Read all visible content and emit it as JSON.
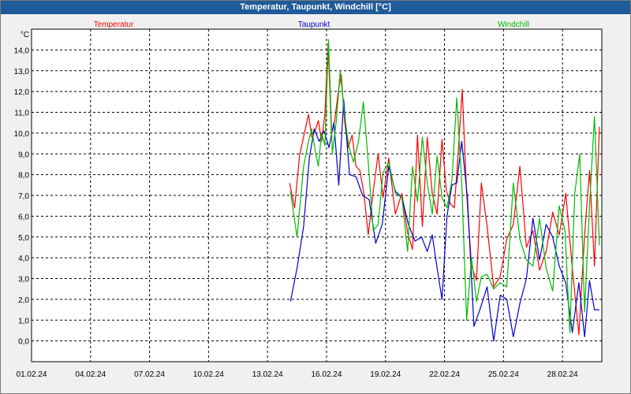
{
  "window": {
    "title": "Temperatur, Taupunkt, Windchill [°C]"
  },
  "chart_data": {
    "type": "line",
    "title": "Temperatur, Taupunkt, Windchill [°C]",
    "ylabel": "°C",
    "ylim": [
      -1.0,
      15.0
    ],
    "y_ticks": [
      0.0,
      1.0,
      2.0,
      3.0,
      4.0,
      5.0,
      6.0,
      7.0,
      8.0,
      9.0,
      10.0,
      11.0,
      12.0,
      13.0,
      14.0
    ],
    "y_tick_labels": [
      "0,0",
      "1,0",
      "2,0",
      "3,0",
      "4,0",
      "5,0",
      "6,0",
      "7,0",
      "8,0",
      "9,0",
      "10,0",
      "11,0",
      "12,0",
      "13,0",
      "14,0"
    ],
    "xlim": [
      "2024-02-01",
      "2024-03-01"
    ],
    "x_ticks": [
      "2024-02-01",
      "2024-02-04",
      "2024-02-07",
      "2024-02-10",
      "2024-02-13",
      "2024-02-16",
      "2024-02-19",
      "2024-02-22",
      "2024-02-25",
      "2024-02-28"
    ],
    "x_tick_labels": [
      "01.02.24",
      "04.02.24",
      "07.02.24",
      "10.02.24",
      "13.02.24",
      "16.02.24",
      "19.02.24",
      "22.02.24",
      "25.02.24",
      "28.02.24"
    ],
    "grid": true,
    "legend": "top",
    "series": [
      {
        "name": "Temperatur",
        "color": "#ff0000",
        "x": [
          "2024-02-14",
          "2024-02-14",
          "2024-02-14",
          "2024-02-14",
          "2024-02-15",
          "2024-02-15",
          "2024-02-15",
          "2024-02-15",
          "2024-02-15",
          "2024-02-15",
          "2024-02-16",
          "2024-02-16",
          "2024-02-16",
          "2024-02-16",
          "2024-02-16",
          "2024-02-16",
          "2024-02-17",
          "2024-02-17",
          "2024-02-17",
          "2024-02-17",
          "2024-02-17",
          "2024-02-18",
          "2024-02-18",
          "2024-02-18",
          "2024-02-18",
          "2024-02-19",
          "2024-02-19",
          "2024-02-19",
          "2024-02-20",
          "2024-02-20",
          "2024-02-20",
          "2024-02-20",
          "2024-02-21",
          "2024-02-21",
          "2024-02-21",
          "2024-02-21",
          "2024-02-22",
          "2024-02-22",
          "2024-02-22",
          "2024-02-22",
          "2024-02-22",
          "2024-02-23",
          "2024-02-23",
          "2024-02-23",
          "2024-02-23",
          "2024-02-24",
          "2024-02-24",
          "2024-02-24",
          "2024-02-25",
          "2024-02-25",
          "2024-02-25",
          "2024-02-26",
          "2024-02-26",
          "2024-02-26",
          "2024-02-27",
          "2024-02-27",
          "2024-02-27",
          "2024-02-28",
          "2024-02-28",
          "2024-02-28",
          "2024-02-29",
          "2024-02-29",
          "2024-02-29",
          "2024-02-29"
        ],
        "values": [
          7.6,
          6.4,
          8.9,
          10.0,
          10.9,
          9.8,
          10.1,
          10.6,
          9.6,
          10.9,
          14.3,
          10.0,
          10.6,
          11.9,
          12.8,
          10.6,
          9.3,
          9.9,
          8.4,
          8.2,
          7.1,
          5.1,
          7.2,
          9.0,
          6.9,
          8.8,
          6.1,
          7.1,
          5.2,
          4.4,
          9.9,
          5.5,
          9.8,
          7.1,
          6.1,
          9.7,
          7.2,
          6.6,
          6.4,
          9.1,
          12.1,
          7.1,
          3.6,
          2.9,
          7.6,
          5.5,
          2.6,
          3.1,
          4.9,
          5.6,
          8.4,
          4.5,
          5.3,
          3.4,
          4.3,
          6.2,
          5.1,
          7.1,
          3.5,
          0.3,
          5.1,
          8.2,
          3.6,
          10.3
        ]
      },
      {
        "name": "Taupunkt",
        "color": "#0000cc",
        "x": [
          "2024-02-14",
          "2024-02-14",
          "2024-02-14",
          "2024-02-15",
          "2024-02-15",
          "2024-02-15",
          "2024-02-15",
          "2024-02-16",
          "2024-02-16",
          "2024-02-16",
          "2024-02-16",
          "2024-02-17",
          "2024-02-17",
          "2024-02-17",
          "2024-02-18",
          "2024-02-18",
          "2024-02-18",
          "2024-02-19",
          "2024-02-19",
          "2024-02-19",
          "2024-02-20",
          "2024-02-20",
          "2024-02-20",
          "2024-02-21",
          "2024-02-21",
          "2024-02-21",
          "2024-02-21",
          "2024-02-22",
          "2024-02-22",
          "2024-02-22",
          "2024-02-22",
          "2024-02-23",
          "2024-02-23",
          "2024-02-23",
          "2024-02-24",
          "2024-02-24",
          "2024-02-24",
          "2024-02-25",
          "2024-02-25",
          "2024-02-25",
          "2024-02-26",
          "2024-02-26",
          "2024-02-26",
          "2024-02-27",
          "2024-02-27",
          "2024-02-27",
          "2024-02-28",
          "2024-02-28",
          "2024-02-28",
          "2024-02-29",
          "2024-02-29",
          "2024-02-29",
          "2024-02-29"
        ],
        "values": [
          1.9,
          3.5,
          5.5,
          8.8,
          10.2,
          9.6,
          10.1,
          9.3,
          10.5,
          7.5,
          11.6,
          8.0,
          7.9,
          7.0,
          6.8,
          4.7,
          5.6,
          8.4,
          7.2,
          6.9,
          5.6,
          4.8,
          5.0,
          4.3,
          5.1,
          3.5,
          2.0,
          6.0,
          7.5,
          7.6,
          9.6,
          6.9,
          0.7,
          1.6,
          2.6,
          0.0,
          2.2,
          2.0,
          0.2,
          1.8,
          3.0,
          5.9,
          3.9,
          5.6,
          5.0,
          3.6,
          2.8,
          0.4,
          2.8,
          0.2,
          2.9,
          1.5,
          1.5
        ]
      },
      {
        "name": "Windchill",
        "color": "#00bb00",
        "x": [
          "2024-02-14",
          "2024-02-14",
          "2024-02-14",
          "2024-02-15",
          "2024-02-15",
          "2024-02-15",
          "2024-02-15",
          "2024-02-15",
          "2024-02-15",
          "2024-02-16",
          "2024-02-16",
          "2024-02-16",
          "2024-02-16",
          "2024-02-16",
          "2024-02-17",
          "2024-02-17",
          "2024-02-17",
          "2024-02-17",
          "2024-02-18",
          "2024-02-18",
          "2024-02-18",
          "2024-02-18",
          "2024-02-19",
          "2024-02-19",
          "2024-02-19",
          "2024-02-20",
          "2024-02-20",
          "2024-02-20",
          "2024-02-20",
          "2024-02-21",
          "2024-02-21",
          "2024-02-21",
          "2024-02-21",
          "2024-02-22",
          "2024-02-22",
          "2024-02-22",
          "2024-02-22",
          "2024-02-23",
          "2024-02-23",
          "2024-02-23",
          "2024-02-23",
          "2024-02-24",
          "2024-02-24",
          "2024-02-24",
          "2024-02-25",
          "2024-02-25",
          "2024-02-25",
          "2024-02-26",
          "2024-02-26",
          "2024-02-26",
          "2024-02-27",
          "2024-02-27",
          "2024-02-27",
          "2024-02-28",
          "2024-02-28",
          "2024-02-28",
          "2024-02-28",
          "2024-02-29",
          "2024-02-29",
          "2024-02-29",
          "2024-02-29"
        ],
        "values": [
          7.2,
          5.0,
          8.4,
          9.6,
          10.2,
          9.2,
          8.4,
          10.0,
          9.4,
          14.5,
          9.0,
          10.6,
          13.0,
          11.0,
          9.4,
          8.6,
          9.6,
          11.5,
          8.6,
          5.3,
          5.6,
          8.1,
          8.6,
          7.1,
          6.9,
          4.3,
          8.4,
          6.7,
          9.8,
          7.6,
          6.1,
          8.9,
          6.9,
          6.4,
          7.7,
          11.7,
          7.6,
          1.0,
          4.0,
          1.9,
          3.1,
          3.2,
          2.5,
          2.8,
          2.6,
          7.6,
          4.9,
          3.9,
          3.6,
          5.9,
          3.5,
          2.4,
          6.5,
          5.3,
          0.4,
          7.1,
          9.0,
          1.4,
          6.5,
          10.8,
          4.6
        ]
      }
    ]
  }
}
